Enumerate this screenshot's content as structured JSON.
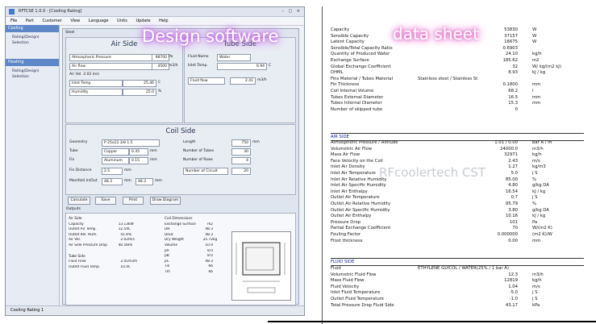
{
  "software": {
    "title": "RFTCSE 1.0.0 - [Cooling Rating]",
    "menu": [
      "File",
      "Part",
      "Customer",
      "View",
      "Language",
      "Units",
      "Update",
      "Help"
    ],
    "sidebar": {
      "cooling_header": "Cooling",
      "cooling_items": [
        "Rating(Design)",
        "Selection"
      ],
      "heating_header": "Heating",
      "heating_items": [
        "Rating(Design)",
        "Selection"
      ]
    },
    "main_header": "Steel",
    "air_side": {
      "title": "Air Side",
      "pressure_label": "Atmospheric Pressure",
      "pressure_value": "98700",
      "pressure_unit": "Pa",
      "flow_label": "Air flow",
      "flow_value": "4500",
      "flow_unit": "m3/h",
      "vel_label": "Air Vel. 2.02 m/s",
      "inlet_temp_label": "Inlet Temp.",
      "inlet_temp_value": "25.46",
      "inlet_temp_unit": "C",
      "humidity_label": "Humidity",
      "humidity_value": "25.0",
      "humidity_unit": "%"
    },
    "tube_side": {
      "title": "Tube Side",
      "fluid_label": "Fluid Name",
      "fluid_value": "Water",
      "inlet_temp_label": "Inlet Temp.",
      "inlet_temp_value": "6.94",
      "inlet_temp_unit": "C",
      "flow_label": "Fluid flow",
      "flow_value": "2.41",
      "flow_unit": "m3/h"
    },
    "coil_side": {
      "title": "Coil Side",
      "geometry_label": "Geometry",
      "geometry_value": "P 25x22 3/8 1.5",
      "length_label": "Length",
      "length_value": "750",
      "length_unit": "mm",
      "tube_label": "Tube",
      "tube_value": "Copper",
      "tube_thk": "0.35",
      "tube_unit": "mm",
      "num_tubes_label": "Number of Tubes",
      "num_tubes_value": "30",
      "fin_label": "Fin",
      "fin_value": "Aluminum",
      "fin_thk": "0.15",
      "fin_unit": "mm",
      "num_rows_label": "Number of Rows",
      "num_rows_value": "4",
      "fin_distance_label": "Fin Distance",
      "fin_distance_value": "2.5",
      "fin_distance_unit": "mm",
      "num_circuit_label": "Number of Circuit",
      "num_circuit_value": "20",
      "manifold_label": "Manifold In/Out",
      "manifold_in": "48.3",
      "manifold_unit1": "mm",
      "manifold_out": "48.3",
      "manifold_unit2": "mm"
    },
    "buttons": [
      "Calculate",
      "Save",
      "Print",
      "Draw Diagram"
    ],
    "outputs_label": "Outputs",
    "results_left": {
      "air_header": "Air Side",
      "air_rows": [
        [
          "Capacity",
          "13.13",
          "kW"
        ],
        [
          "Outlet Air Temp.",
          "12.54",
          "C"
        ],
        [
          "Outlet Rel. Hum.",
          "41.6",
          "%"
        ],
        [
          "Air Vel.",
          "2.02",
          "m/s"
        ],
        [
          "Air Side Pressure Drop",
          "40.56",
          "Pa"
        ]
      ],
      "tube_header": "Tube Side",
      "tube_rows": [
        [
          "Fluid Flow",
          "2.41",
          "m3/h"
        ],
        [
          "Outlet Fluid Temp.",
          "10.4",
          "C"
        ]
      ]
    },
    "results_right": {
      "header": "Coil Dimensions",
      "rows": [
        [
          "Exchange Surface 37.8",
          "m2"
        ],
        [
          "DH",
          "48.3"
        ],
        [
          "Dout",
          "48.3"
        ],
        [
          "Dry Weight",
          "25.72",
          "kg"
        ],
        [
          "Volume",
          "10.9"
        ],
        [
          "pA",
          "8.0"
        ],
        [
          "pB",
          "8.0"
        ],
        [
          "pC",
          "48.3"
        ],
        [
          "Tin",
          "66"
        ],
        [
          "Tm",
          "66"
        ]
      ]
    },
    "status": "Cooling Rating 1",
    "overlay": "Design software"
  },
  "datasheet": {
    "overlay": "data sheet",
    "watermark": "RFcoolertech CST",
    "top_rows": [
      [
        "Capacity",
        "53830",
        "W"
      ],
      [
        "Sensible Capacity",
        "37157",
        "W"
      ],
      [
        "Latent Capacity",
        "16675",
        "W"
      ],
      [
        "Sensible/Total Capacity Ratio",
        "0.6903",
        ""
      ],
      [
        "Quantity of Produced Water",
        "24.10",
        "kg/h"
      ],
      [
        "Exchange Surface",
        "185.62",
        "m2"
      ],
      [
        "Global Exchange Coefficient",
        "32",
        "W/ kg/(m2 kJ)"
      ],
      [
        "DHML",
        "8.93",
        "kJ / kg"
      ]
    ],
    "fins_row": [
      "Fins Material / Tubes Material",
      "Stainless steel / Stainless St"
    ],
    "mid_rows": [
      [
        "Fin Thickness",
        "0.1800",
        "mm"
      ],
      [
        "Coil Internal Volume",
        "68.2",
        "l"
      ],
      [
        "Tubes External Diameter",
        "16.5",
        "mm"
      ],
      [
        "Tubes Internal Diameter",
        "15.3",
        "mm"
      ],
      [
        "Number of skipped tube",
        "0",
        ""
      ]
    ],
    "air_section": "AIR SIDE",
    "air_rows": [
      [
        "Atmospheric Pressure / Altitude",
        "1.01 / 0.00",
        "bar A / m"
      ],
      [
        "Volumetric Air Flow",
        "24000.0",
        "m3/h"
      ],
      [
        "Mass Air Flow",
        "32971",
        "kg/h"
      ],
      [
        "Face Velocity on the Coil",
        "2.43",
        "m/s"
      ],
      [
        "Inlet Air Density",
        "1.27",
        "kg/m3"
      ],
      [
        "Inlet Air Temperature",
        "5.0",
        "j S"
      ],
      [
        "Inlet Air Relative Humidity",
        "85.00",
        "%"
      ],
      [
        "Inlet Air Specific Humidity",
        "4.80",
        "g/kg DA"
      ],
      [
        "Inlet Air Enthalpy",
        "16.54",
        "kJ / kg"
      ],
      [
        "Outlet Air Temperature",
        "0.7",
        "j S"
      ],
      [
        "Outlet Air Relative Humidity",
        "95.79",
        "%"
      ],
      [
        "Outlet Air Specific Humidity",
        "3.80",
        "g/kg DA"
      ],
      [
        "Outlet Air Enthalpy",
        "10.16",
        "kJ / kg"
      ],
      [
        "Pressure Drop",
        "101",
        "Pa"
      ],
      [
        "Partial Exchange Coefficient",
        "70",
        "W/(m2 K)"
      ],
      [
        "Fouling Factor",
        "0.000000",
        "(m2 K)/W"
      ],
      [
        "Frost thickness",
        "0.00",
        "mm"
      ]
    ],
    "fluid_section": "FLUID SIDE",
    "fluid_row": [
      "Fluid",
      "ETHYLENE GLYCOL / WATER(25% / 1 bar A)"
    ],
    "fluid_rows": [
      [
        "Volumetric Fluid Flow",
        "12.3",
        "m3/h"
      ],
      [
        "Mass Fluid Flow",
        "12819",
        "kg/h"
      ],
      [
        "Fluid Velocity",
        "1.04",
        "m/s"
      ],
      [
        "Inlet Fluid Temperature",
        "-5.0",
        "j S"
      ],
      [
        "Outlet Fluid Temperature",
        "-1.0",
        "j S"
      ],
      [
        "Total Pressure Drop Fluid Side",
        "43.17",
        "kPa"
      ]
    ]
  }
}
